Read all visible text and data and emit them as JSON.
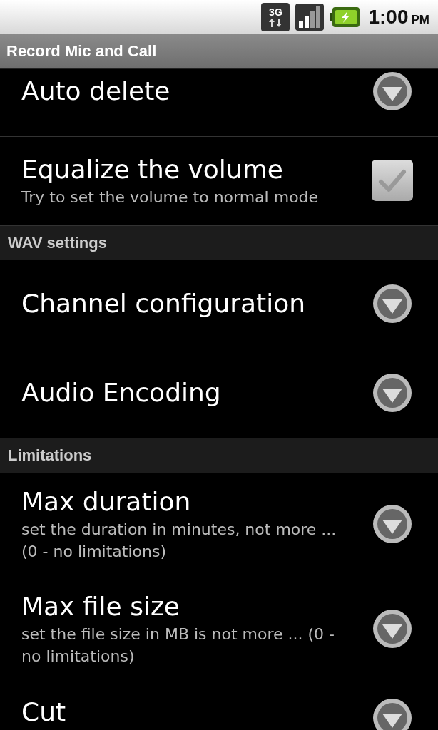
{
  "status_bar": {
    "network_type": "3G",
    "time": "1:00",
    "period": "PM"
  },
  "app_title": "Record Mic and Call",
  "items": [
    {
      "kind": "list",
      "title": "Auto delete"
    },
    {
      "kind": "checkbox",
      "title": "Equalize the volume",
      "summary": "Try to set the volume to normal mode",
      "checked": true,
      "disabled": true
    },
    {
      "kind": "header",
      "title": "WAV settings"
    },
    {
      "kind": "list",
      "title": "Channel configuration"
    },
    {
      "kind": "list",
      "title": "Audio Encoding"
    },
    {
      "kind": "header",
      "title": "Limitations"
    },
    {
      "kind": "list",
      "title": "Max duration",
      "summary": "set the duration in minutes, not more ... (0 - no limitations)"
    },
    {
      "kind": "list",
      "title": "Max file size",
      "summary": "set the file size in MB is not more ... (0 - no limitations)"
    },
    {
      "kind": "list",
      "title": "Cut"
    }
  ]
}
